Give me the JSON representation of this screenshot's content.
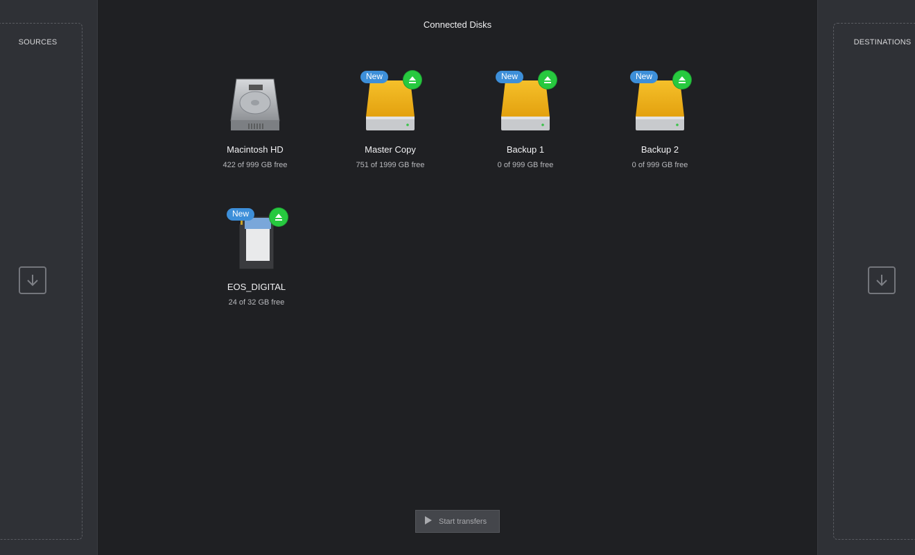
{
  "window": {
    "traffic_light_color": "#29d13c"
  },
  "sources": {
    "title": "SOURCES",
    "drop_icon": "download-arrow-icon"
  },
  "destinations": {
    "title": "DESTINATIONS",
    "drop_icon": "download-arrow-icon"
  },
  "main": {
    "title": "Connected Disks",
    "disks": [
      {
        "name": "Macintosh HD",
        "free": "422 of 999 GB free",
        "icon": "internal-hard-drive-icon",
        "new": false,
        "ejectable": false
      },
      {
        "name": "Master Copy",
        "free": "751 of 1999 GB free",
        "icon": "external-drive-icon",
        "new": true,
        "badge": "New",
        "ejectable": true
      },
      {
        "name": "Backup 1",
        "free": "0 of 999 GB free",
        "icon": "external-drive-icon",
        "new": true,
        "badge": "New",
        "ejectable": true
      },
      {
        "name": "Backup 2",
        "free": "0 of 999 GB free",
        "icon": "external-drive-icon",
        "new": true,
        "badge": "New",
        "ejectable": true
      },
      {
        "name": "EOS_DIGITAL",
        "free": "24 of 32 GB free",
        "icon": "sd-card-icon",
        "new": true,
        "badge": "New",
        "ejectable": true
      }
    ]
  },
  "footer": {
    "start_label": "Start transfers",
    "start_icon": "play-icon"
  },
  "colors": {
    "badge": "#3d8fd9",
    "eject": "#27c93f",
    "drive_yellow": "#f2b21a"
  }
}
